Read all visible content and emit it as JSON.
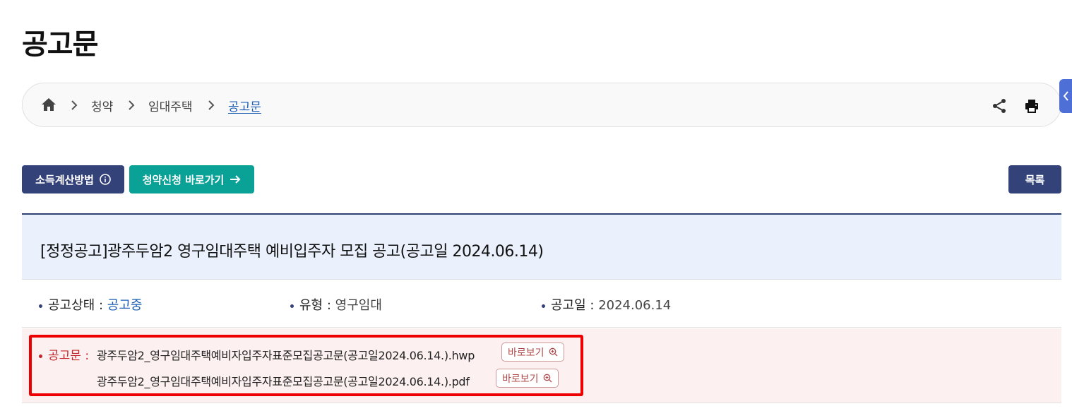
{
  "page": {
    "title": "공고문"
  },
  "breadcrumb": {
    "home_icon": "home-icon",
    "items": [
      "청약",
      "임대주택",
      "공고문"
    ]
  },
  "toolbar": {
    "share_icon": "share-icon",
    "print_icon": "print-icon"
  },
  "buttons": {
    "income_calc": "소득계산방법",
    "apply_shortcut": "청약신청 바로가기",
    "list": "목록"
  },
  "notice": {
    "title": "[정정공고]광주두암2 영구임대주택 예비입주자 모집 공고(공고일 2024.06.14)",
    "status_label": "공고상태 :",
    "status_value": "공고중",
    "type_label": "유형 :",
    "type_value": "영구임대",
    "date_label": "공고일 :",
    "date_value": "2024.06.14"
  },
  "files": {
    "label": "공고문 :",
    "view_label": "바로보기",
    "items": [
      "광주두암2_영구임대주택예비자입주자표준모집공고문(공고일2024.06.14.).hwp",
      "광주두암2_영구임대주택예비자입주자표준모집공고문(공고일2024.06.14.).pdf"
    ]
  },
  "colors": {
    "navy": "#34427a",
    "teal": "#0aa196",
    "highlight_red": "#ee0000",
    "link_blue": "#1a5fb4"
  }
}
